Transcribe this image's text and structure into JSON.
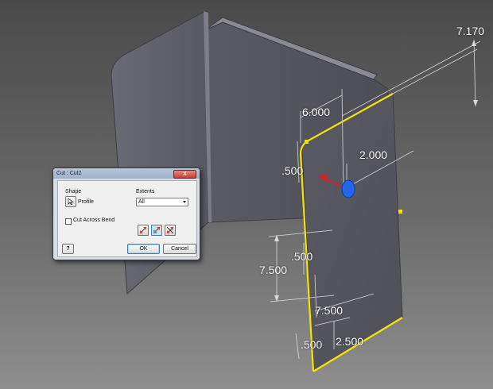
{
  "viewport": {
    "dimensions": [
      "7.170",
      "6.000",
      "2.000",
      ".500",
      ".500",
      "7.500",
      "7.500",
      ".500",
      "2.500"
    ]
  },
  "dialog": {
    "title": "Cut : Cut2",
    "close_label": "X",
    "shape": {
      "label": "Shape",
      "profile_label": "Profile"
    },
    "extents": {
      "label": "Extents",
      "selected": "All"
    },
    "cut_across_bend_label": "Cut Across Bend",
    "help_label": "?",
    "ok_label": "OK",
    "cancel_label": "Cancel"
  },
  "colors": {
    "sketch_highlight": "#f2e600",
    "panel": "#55555e",
    "direction_arrow": "#d42222",
    "origin_marker": "#2266ee"
  }
}
